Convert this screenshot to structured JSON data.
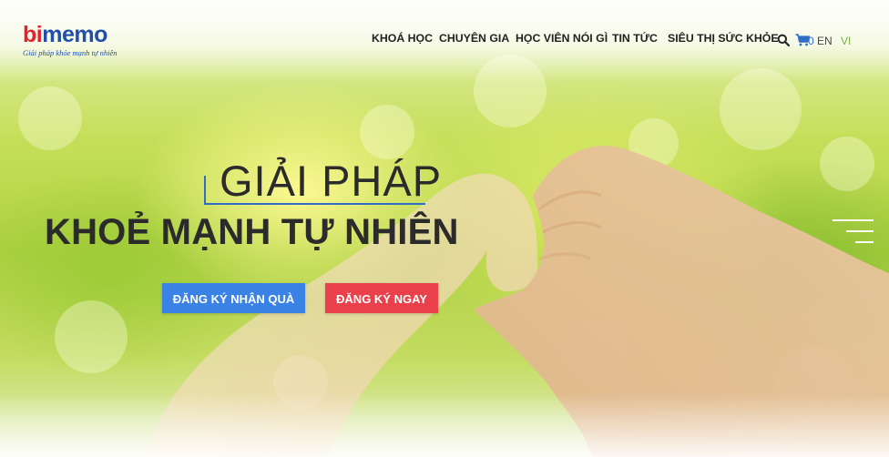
{
  "brand": {
    "name_part1": "bi",
    "name_part2": "memo",
    "tagline": "Giải pháp khỏe mạnh tự nhiên",
    "brand_blue": "#1f4fa8",
    "brand_red": "#e4212c"
  },
  "nav": {
    "items": [
      {
        "label": "KHOÁ HỌC"
      },
      {
        "label": "CHUYÊN GIA"
      },
      {
        "label": "HỌC VIÊN NÓI GÌ"
      },
      {
        "label": "TIN TỨC"
      },
      {
        "label": "SIÊU THỊ SỨC KHỎE"
      }
    ],
    "search_icon": "search-icon",
    "cart_icon": "shopping-cart-icon",
    "cart_count": "0",
    "lang_en": "EN",
    "lang_vi": "VI",
    "active_lang_color": "#7cb342"
  },
  "hero": {
    "title_line1": "GIẢI PHÁP",
    "title_line2": "KHOẺ MẠNH TỰ NHIÊN",
    "accent_color": "#2f6dc9",
    "cta_primary": "ĐĂNG KÝ NHẬN QUÀ",
    "cta_primary_color": "#3b82e6",
    "cta_secondary": "ĐĂNG KÝ NGAY",
    "cta_secondary_color": "#e9404b",
    "menu_icon": "hamburger-menu-icon"
  }
}
